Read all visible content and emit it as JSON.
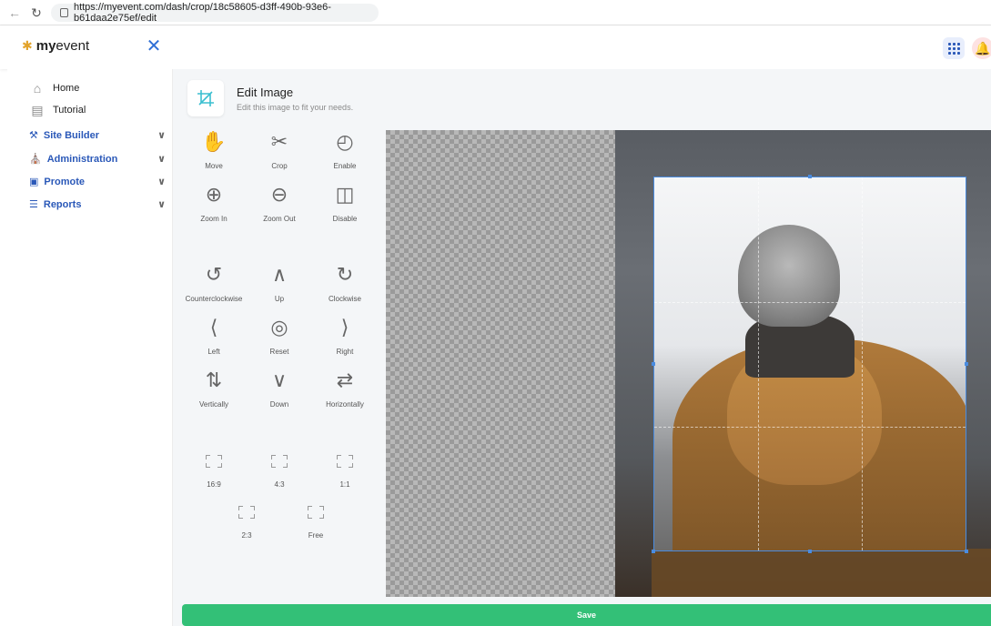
{
  "browser": {
    "url": "https://myevent.com/dash/crop/18c58605-d3ff-490b-93e6-b61daa2e75ef/edit"
  },
  "header": {
    "logo_prefix": "my",
    "logo_suffix": "event"
  },
  "sidebar": {
    "items": [
      {
        "label": "Home",
        "icon": "home-icon"
      },
      {
        "label": "Tutorial",
        "icon": "books-icon"
      }
    ],
    "sections": [
      {
        "label": "Site Builder",
        "icon": "wrench-icon"
      },
      {
        "label": "Administration",
        "icon": "building-icon"
      },
      {
        "label": "Promote",
        "icon": "megaphone-icon"
      },
      {
        "label": "Reports",
        "icon": "chart-icon"
      }
    ]
  },
  "editor": {
    "title": "Edit Image",
    "subtitle": "Edit this image to fit your needs.",
    "tools": [
      {
        "label": "Move",
        "icon": "hand-icon"
      },
      {
        "label": "Crop",
        "icon": "scissors-icon"
      },
      {
        "label": "Enable",
        "icon": "unlock-icon"
      },
      {
        "label": "Zoom In",
        "icon": "zoom-in-icon"
      },
      {
        "label": "Zoom Out",
        "icon": "zoom-out-icon"
      },
      {
        "label": "Disable",
        "icon": "lock-icon"
      },
      {
        "label": "Counterclockwise",
        "icon": "rotate-left-icon"
      },
      {
        "label": "Up",
        "icon": "chevron-up-icon"
      },
      {
        "label": "Clockwise",
        "icon": "rotate-right-icon"
      },
      {
        "label": "Left",
        "icon": "chevron-left-icon"
      },
      {
        "label": "Reset",
        "icon": "reset-icon"
      },
      {
        "label": "Right",
        "icon": "chevron-right-icon"
      },
      {
        "label": "Vertically",
        "icon": "flip-vertical-icon"
      },
      {
        "label": "Down",
        "icon": "chevron-down-icon"
      },
      {
        "label": "Horizontally",
        "icon": "flip-horizontal-icon"
      }
    ],
    "ratios": [
      {
        "label": "16:9"
      },
      {
        "label": "4:3"
      },
      {
        "label": "1:1"
      },
      {
        "label": "2:3"
      },
      {
        "label": "Free"
      }
    ],
    "save_label": "Save"
  },
  "colors": {
    "accent": "#2a58b8",
    "crop_border": "#4a8ce0",
    "save": "#33c077",
    "crop_icon": "#3bbfd0"
  }
}
